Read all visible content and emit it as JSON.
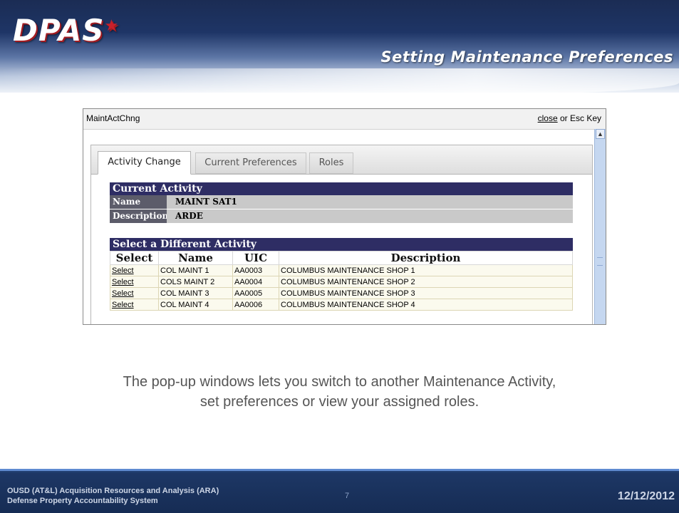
{
  "header": {
    "logo_text": "DPAS",
    "slide_title": "Setting Maintenance Preferences"
  },
  "popup": {
    "title": "MaintActChng",
    "close_link": "close",
    "close_suffix": " or Esc Key",
    "tabs": [
      {
        "label": "Activity Change",
        "active": true
      },
      {
        "label": "Current Preferences",
        "active": false
      },
      {
        "label": "Roles",
        "active": false
      }
    ],
    "current_activity": {
      "heading": "Current Activity",
      "name_label": "Name",
      "name_value": "MAINT SAT1",
      "description_label": "Description",
      "description_value": "ARDE"
    },
    "select_activity": {
      "heading": "Select a Different Activity",
      "columns": [
        "Select",
        "Name",
        "UIC",
        "Description"
      ],
      "rows": [
        {
          "select": "Select",
          "name": "COL MAINT 1",
          "uic": "AA0003",
          "description": "COLUMBUS MAINTENANCE SHOP 1"
        },
        {
          "select": "Select",
          "name": "COLS MAINT 2",
          "uic": "AA0004",
          "description": "COLUMBUS MAINTENANCE SHOP 2"
        },
        {
          "select": "Select",
          "name": "COL MAINT 3",
          "uic": "AA0005",
          "description": "COLUMBUS MAINTENANCE SHOP 3"
        },
        {
          "select": "Select",
          "name": "COL MAINT 4",
          "uic": "AA0006",
          "description": "COLUMBUS MAINTENANCE SHOP 4"
        }
      ]
    }
  },
  "caption": {
    "line1": "The pop-up windows lets you switch to another Maintenance Activity,",
    "line2": "set preferences or view your assigned roles."
  },
  "footer": {
    "line1": "OUSD (AT&L) Acquisition Resources and Analysis (ARA)",
    "line2": "Defense Property Accountability System",
    "page": "7",
    "date": "12/12/2012"
  },
  "colors": {
    "header_dark": "#1b2c54",
    "section_header": "#2e2d64",
    "footer": "#162c54"
  }
}
